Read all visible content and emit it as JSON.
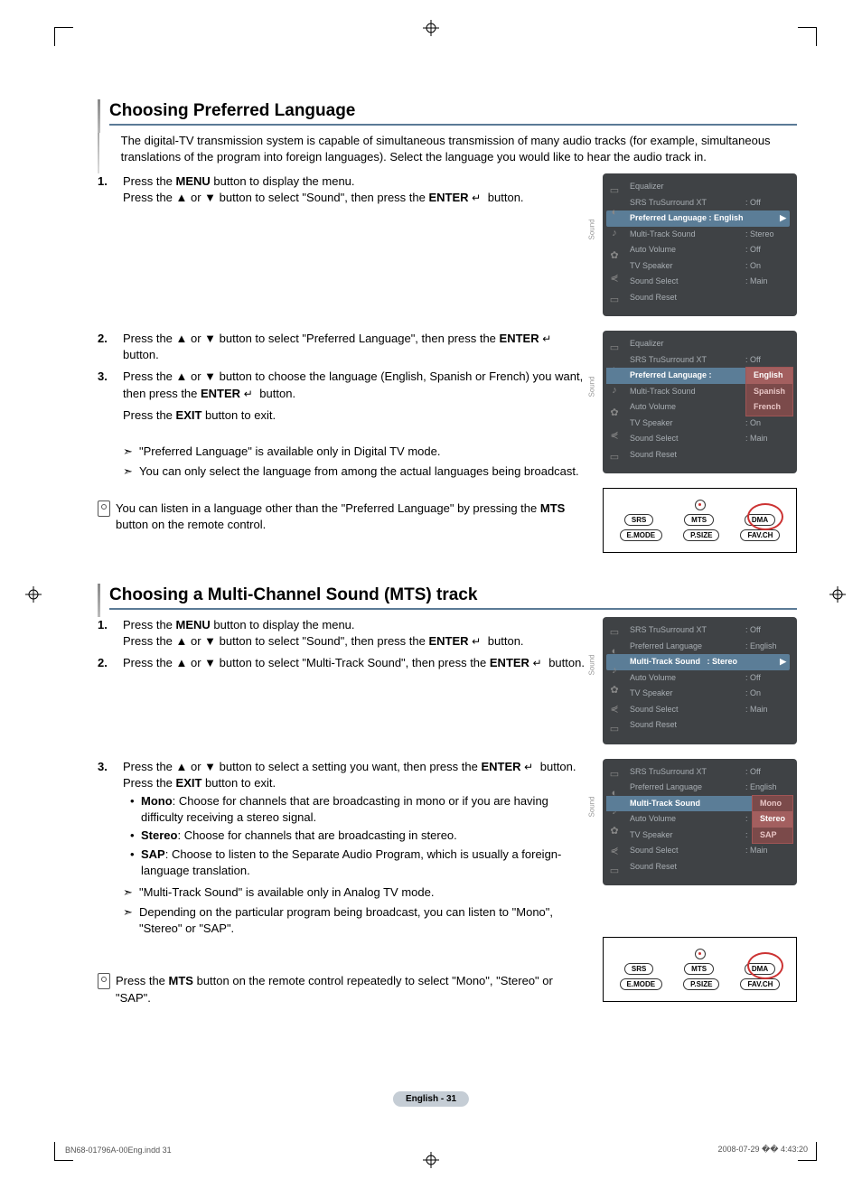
{
  "section1": {
    "title": "Choosing Preferred Language",
    "intro": "The digital-TV transmission system is capable of simultaneous transmission of many audio tracks (for example, simultaneous translations of the program into foreign languages).\nSelect the language you would like to hear the audio track in.",
    "step1a": "Press the ",
    "step1_menu": "MENU",
    "step1b": " button to display the menu.",
    "step1c": "Press the ▲ or ▼ button to select \"Sound\", then press the ",
    "step1_enter": "ENTER",
    "step1d": " button.",
    "step2a": "Press the ▲ or ▼ button to select \"Preferred Language\", then press the ",
    "step2_enter": "ENTER",
    "step2b": " button.",
    "step3a": "Press the ▲ or ▼ button to choose the language (English, Spanish or French) you want, then press the ",
    "step3_enter": "ENTER",
    "step3b": " button.",
    "step3c": "Press the ",
    "step3_exit": "EXIT",
    "step3d": " button to exit.",
    "note1": "\"Preferred Language\" is available only in Digital TV mode.",
    "note2": "You can only select the language from among the actual languages being broadcast.",
    "remote1a": "You can listen in a language other than the \"Preferred Language\" by pressing the ",
    "remote1_mts": "MTS",
    "remote1b": " button on the remote control."
  },
  "section2": {
    "title": "Choosing a Multi-Channel Sound (MTS) track",
    "step1a": "Press the ",
    "step1_menu": "MENU",
    "step1b": " button to display the menu.",
    "step1c": "Press the ▲ or ▼ button to select \"Sound\", then press the ",
    "step1_enter": "ENTER",
    "step1d": " button.",
    "step2a": "Press the ▲ or ▼ button to select \"Multi-Track Sound\", then press the ",
    "step2_enter": "ENTER",
    "step2b": " button.",
    "step3a": "Press the ▲ or ▼ button to select a setting you want, then press the ",
    "step3_enter": "ENTER",
    "step3c": " button. Press the ",
    "step3_exit": "EXIT",
    "step3d": " button to exit.",
    "b1_label": "Mono",
    "b1": ": Choose for channels that are broadcasting in mono or if you are having difficulty receiving a stereo signal.",
    "b2_label": "Stereo",
    "b2": ": Choose for channels that are broadcasting in stereo.",
    "b3_label": "SAP",
    "b3": ": Choose to listen to the Separate Audio Program, which is usually a foreign-language translation.",
    "note1": "\"Multi-Track Sound\" is available only in Analog TV mode.",
    "note2": "Depending on the particular program being broadcast, you can listen to \"Mono\", \"Stereo\" or \"SAP\".",
    "remote1a": "Press the ",
    "remote1_mts": "MTS",
    "remote1b": " button on the remote control repeatedly to select \"Mono\", \"Stereo\" or \"SAP\"."
  },
  "tv1": {
    "side": "Sound",
    "r1": "Equalizer",
    "r1v": "",
    "r2": "SRS TruSurround XT",
    "r2v": ": Off",
    "r3": "Preferred Language : English",
    "r3arrow": "▶",
    "r4": "Multi-Track Sound",
    "r4v": ": Stereo",
    "r5": "Auto Volume",
    "r5v": ": Off",
    "r6": "TV Speaker",
    "r6v": ": On",
    "r7": "Sound Select",
    "r7v": ": Main",
    "r8": "Sound Reset"
  },
  "tv2": {
    "side": "Sound",
    "r1": "Equalizer",
    "r2": "SRS TruSurround XT",
    "r2v": ": Off",
    "r3": "Preferred Language :",
    "r4": "Multi-Track Sound",
    "r4v": ":",
    "r5": "Auto Volume",
    "r5v": ":",
    "r6": "TV Speaker",
    "r6v": ": On",
    "r7": "Sound Select",
    "r7v": ": Main",
    "r8": "Sound Reset",
    "dd1": "English",
    "dd2": "Spanish",
    "dd3": "French"
  },
  "tv3": {
    "side": "Sound",
    "r1": "SRS TruSurround XT",
    "r1v": ": Off",
    "r2": "Preferred Language",
    "r2v": ": English",
    "r3": "Multi-Track Sound",
    "r3v": ": Stereo",
    "r3arrow": "▶",
    "r4": "Auto Volume",
    "r4v": ": Off",
    "r5": "TV Speaker",
    "r5v": ": On",
    "r6": "Sound Select",
    "r6v": ": Main",
    "r7": "Sound Reset"
  },
  "tv4": {
    "side": "Sound",
    "r1": "SRS TruSurround XT",
    "r1v": ": Off",
    "r2": "Preferred Language",
    "r2v": ": English",
    "r3": "Multi-Track Sound",
    "r3v": ":",
    "r4": "Auto Volume",
    "r4v": ":",
    "r5": "TV Speaker",
    "r5v": ":",
    "r6": "Sound Select",
    "r6v": ": Main",
    "r7": "Sound Reset",
    "dd1": "Mono",
    "dd2": "Stereo",
    "dd3": "SAP"
  },
  "remote": {
    "b1": "SRS",
    "b2": "MTS",
    "b3": "DMA",
    "b4": "E.MODE",
    "b5": "P.SIZE",
    "b6": "FAV.CH"
  },
  "page_num": "English - 31",
  "footer_left": "BN68-01796A-00Eng.indd   31",
  "footer_right": "2008-07-29   �� 4:43:20"
}
